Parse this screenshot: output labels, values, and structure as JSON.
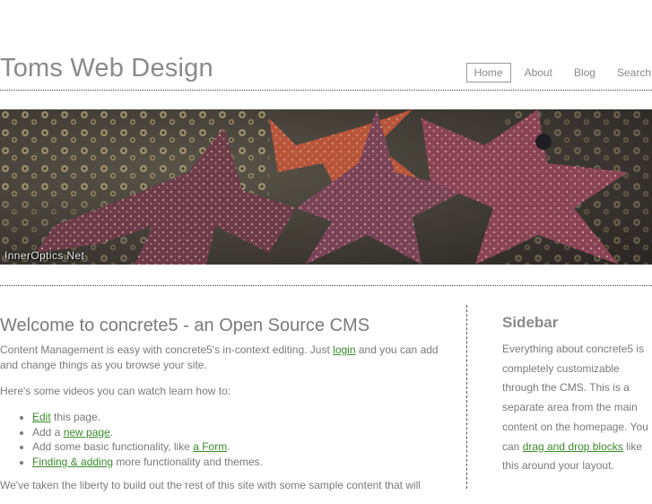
{
  "header": {
    "site_title": "Toms Web Design",
    "nav": [
      {
        "label": "Home",
        "active": true
      },
      {
        "label": "About",
        "active": false
      },
      {
        "label": "Blog",
        "active": false
      },
      {
        "label": "Search",
        "active": false
      }
    ]
  },
  "banner": {
    "credit": "InnerOptics.Net"
  },
  "main": {
    "title": "Welcome to concrete5 - an Open Source CMS",
    "intro_before": "Content Management is easy with concrete5's in-context editing. Just ",
    "intro_link": "login",
    "intro_after": " and you can add and change things as you browse your site.",
    "videos_intro": "Here's some videos you can watch learn how to:",
    "list": [
      {
        "link": "Edit",
        "text": " this page.",
        "before": ""
      },
      {
        "before": "Add a ",
        "link": "new page",
        "text": "."
      },
      {
        "before": "Add some basic functionality, like ",
        "link": "a Form",
        "text": "."
      },
      {
        "before": "",
        "link": "Finding & adding",
        "text": " more functionality and themes."
      }
    ],
    "closing": "We've taken the liberty to build out the rest of this site with some sample content that will"
  },
  "sidebar": {
    "title": "Sidebar",
    "text_before": "Everything about concrete5 is completely customizable through the CMS. This is a separate area from the main content on the homepage. You can ",
    "link": "drag and drop blocks",
    "text_after": " like this around your layout."
  },
  "colors": {
    "link": "#3a8a2a",
    "text": "#7a7a7a",
    "title": "#8a8a8a"
  }
}
